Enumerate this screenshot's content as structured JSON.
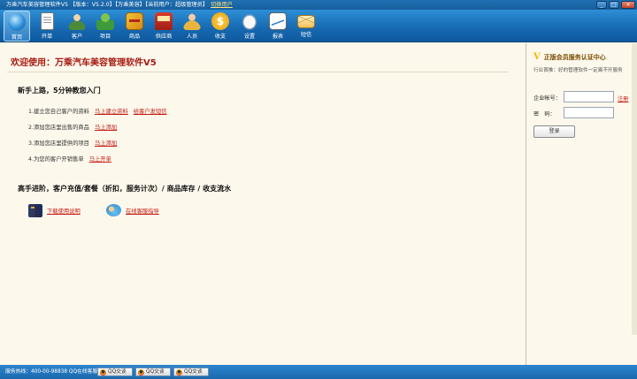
{
  "title_bar": {
    "text": "万乘汽车美容管理软件V5 【版本：V5.2.0】【万乘美容】【当前用户：超级管理员】",
    "switch_user": "切换用户",
    "controls": [
      "_",
      "□",
      "×"
    ]
  },
  "toolbar": {
    "items": [
      {
        "label": "首页",
        "icon": "home-globe-icon"
      },
      {
        "label": "开单",
        "icon": "document-icon"
      },
      {
        "label": "客户",
        "icon": "customer-icon"
      },
      {
        "label": "项目",
        "icon": "project-icon"
      },
      {
        "label": "商品",
        "icon": "goods-icon"
      },
      {
        "label": "供应商",
        "icon": "supplier-icon"
      },
      {
        "label": "人员",
        "icon": "staff-icon"
      },
      {
        "label": "收支",
        "icon": "money-icon"
      },
      {
        "label": "设置",
        "icon": "mouse-icon"
      },
      {
        "label": "报表",
        "icon": "report-icon"
      },
      {
        "label": "短信",
        "icon": "mail-icon"
      }
    ],
    "money_glyph": "$"
  },
  "main": {
    "welcome": "欢迎使用：万乘汽车美容管理软件V5",
    "section1_title": "新手上路，5分钟教您入门",
    "steps": [
      {
        "text": "1.建立您自己客户的资料",
        "link1": "马上建立资料",
        "link2": "给客户发短信"
      },
      {
        "text": "2.添加您店里出售的商品",
        "link1": "马上添加"
      },
      {
        "text": "3.添加您店里提供的项目",
        "link1": "马上添加"
      },
      {
        "text": "4.为您的客户开销售单",
        "link1": "马上开单"
      }
    ],
    "section2_title": "高手进阶，客户充值/套餐（折扣，服务计次）/ 商品库存 / 收支流水",
    "download_link": "下载使用说明",
    "support_link": "在线客服指导"
  },
  "side": {
    "title": "正版会员服务认证中心",
    "title_icon": "V",
    "subtitle": "行业首推：好的管理软件一定离不开服务",
    "account_label": "企业帐号：",
    "password_label": "密　码：",
    "register_link": "注册",
    "login_button": "登录"
  },
  "status_bar": {
    "text": "服务热线：400-00-98838 QQ在线客服：",
    "qq_buttons": [
      "QQ交谈",
      "QQ交谈",
      "QQ交谈"
    ]
  },
  "colors": {
    "accent_blue": "#1668b0",
    "link_red": "#c41a12",
    "background": "#fdf8ec"
  }
}
